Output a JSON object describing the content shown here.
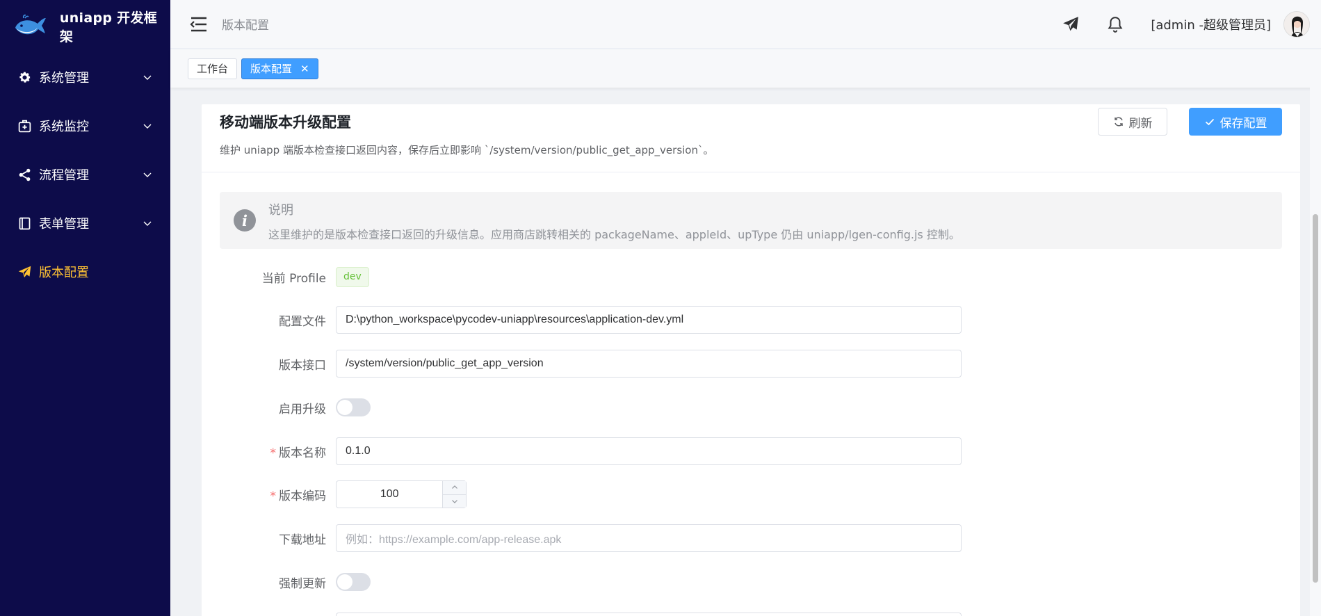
{
  "app": {
    "title": "uniapp 开发框架"
  },
  "sidebar": {
    "items": [
      {
        "label": "系统管理",
        "icon": "gear-icon"
      },
      {
        "label": "系统监控",
        "icon": "monitor-icon"
      },
      {
        "label": "流程管理",
        "icon": "share-icon"
      },
      {
        "label": "表单管理",
        "icon": "form-icon"
      },
      {
        "label": "版本配置",
        "icon": "send-icon",
        "active": true
      }
    ]
  },
  "header": {
    "breadcrumb": "版本配置",
    "user": "[admin -超级管理员]"
  },
  "tags": [
    {
      "label": "工作台"
    },
    {
      "label": "版本配置",
      "active": true
    }
  ],
  "page": {
    "title": "移动端版本升级配置",
    "description": "维护 uniapp 端版本检查接口返回内容，保存后立即影响 `/system/version/public_get_app_version`。",
    "refresh_label": "刷新",
    "save_label": "保存配置"
  },
  "alert": {
    "title": "说明",
    "text": "这里维护的是版本检查接口返回的升级信息。应用商店跳转相关的 packageName、appleId、upType 仍由 uniapp/lgen-config.js 控制。"
  },
  "form": {
    "profile_label": "当前 Profile",
    "profile_value": "dev",
    "config_file_label": "配置文件",
    "config_file_value": "D:\\python_workspace\\pycodev-uniapp\\resources\\application-dev.yml",
    "api_label": "版本接口",
    "api_value": "/system/version/public_get_app_version",
    "enable_label": "启用升级",
    "enable_value": false,
    "version_name_label": "版本名称",
    "version_name_value": "0.1.0",
    "version_code_label": "版本编码",
    "version_code_value": "100",
    "download_label": "下载地址",
    "download_placeholder": "例如：https://example.com/app-release.apk",
    "force_label": "强制更新",
    "force_value": false
  },
  "colors": {
    "sidebar_bg": "#0d0c4a",
    "active_menu": "#ffc233",
    "primary": "#409eff",
    "success": "#67c23a",
    "required": "#f56c6c"
  }
}
